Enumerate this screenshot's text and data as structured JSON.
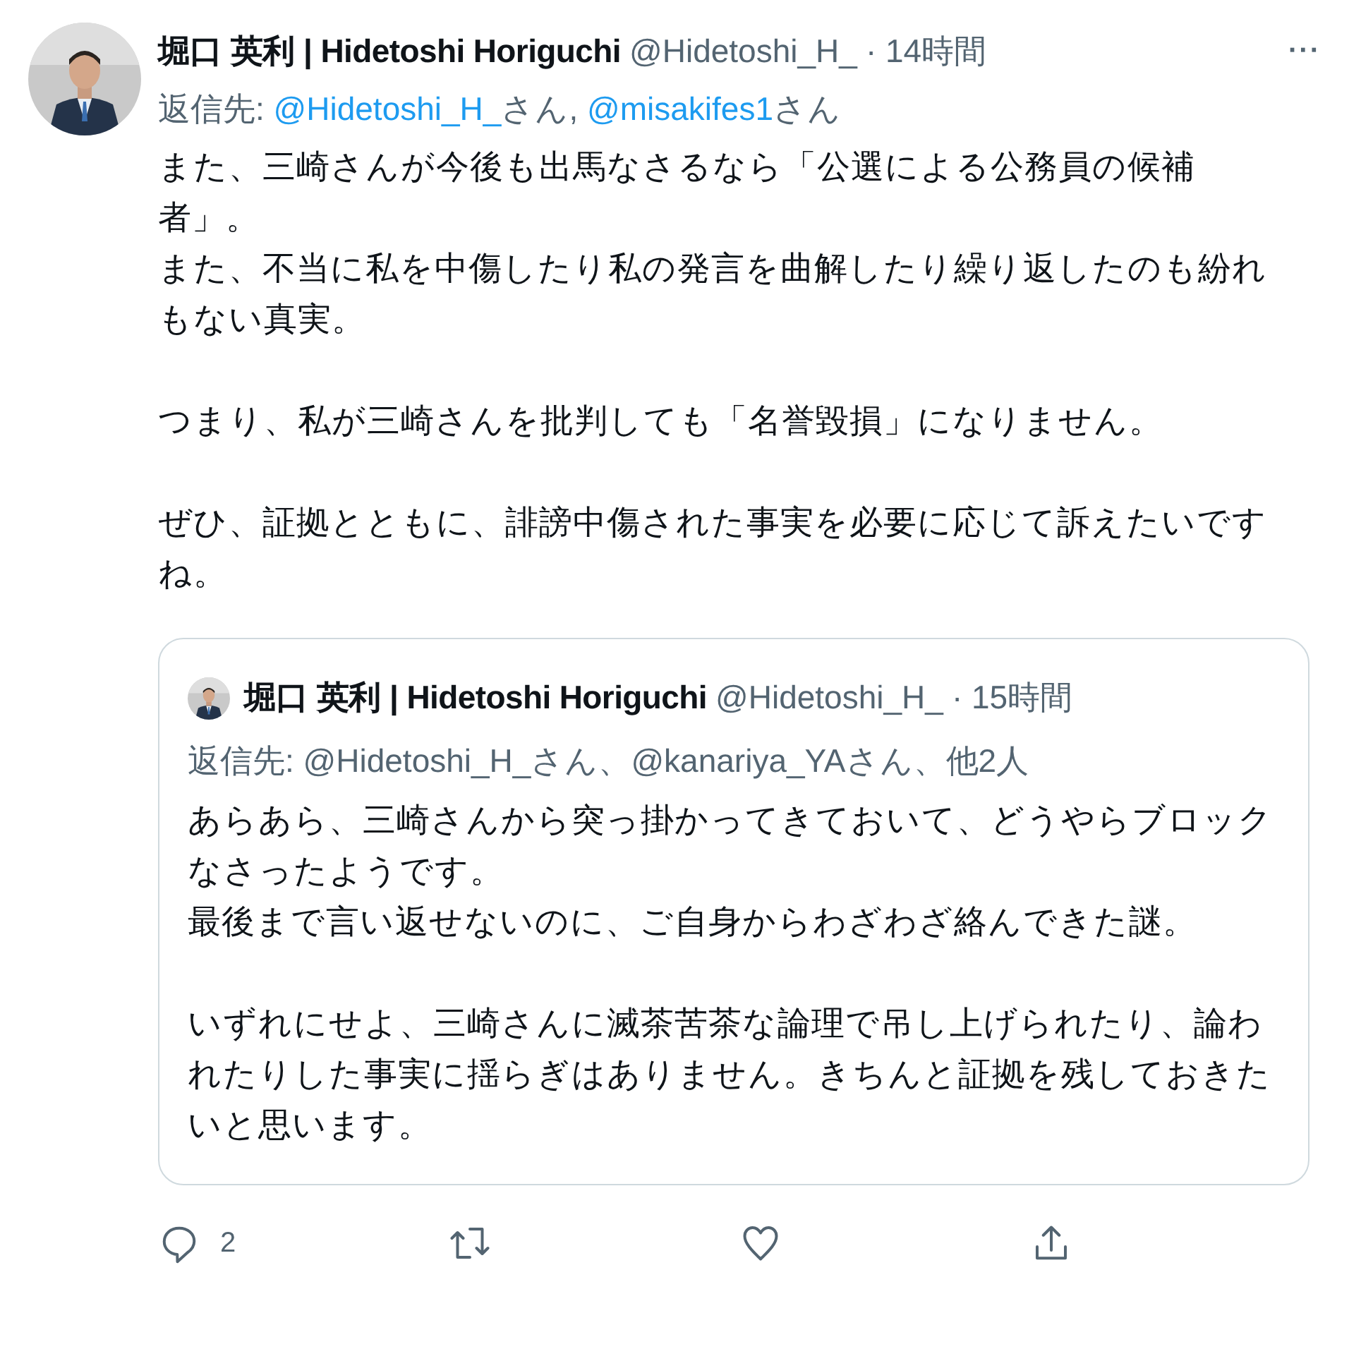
{
  "tweet": {
    "name": "堀口 英利 | Hidetoshi Horiguchi",
    "handle": "@Hidetoshi_H_",
    "time": "· 14時間",
    "more": "···",
    "reply_to": [
      {
        "kind": "plain",
        "text": "返信先: "
      },
      {
        "kind": "mention",
        "text": "@Hidetoshi_H_"
      },
      {
        "kind": "plain",
        "text": "さん, "
      },
      {
        "kind": "mention",
        "text": "@misakifes1"
      },
      {
        "kind": "plain",
        "text": "さん"
      }
    ],
    "paragraphs": [
      [
        "また、三崎さんが今後も出馬なさるなら「公選による公務員の候補者」。",
        "また、不当に私を中傷したり私の発言を曲解したり繰り返したのも紛れもない真実。"
      ],
      [
        "つまり、私が三崎さんを批判しても「名誉毀損」になりません。"
      ],
      [
        "ぜひ、証拠とともに、誹謗中傷された事実を必要に応じて訴えたいですね。"
      ]
    ],
    "quote": {
      "name": "堀口 英利 | Hidetoshi Horiguchi",
      "handle": "@Hidetoshi_H_",
      "time": "· 15時間",
      "reply_to": "返信先: @Hidetoshi_H_さん、@kanariya_YAさん、他2人",
      "paragraphs": [
        [
          "あらあら、三崎さんから突っ掛かってきておいて、どうやらブロックなさったようです。",
          "最後まで言い返せないのに、ご自身からわざわざ絡んできた謎。"
        ],
        [
          "いずれにせよ、三崎さんに滅茶苦茶な論理で吊し上げられたり、論われたりした事実に揺らぎはありません。きちんと証拠を残しておきたいと思います。"
        ]
      ]
    },
    "actions": [
      {
        "kind": "reply",
        "count": "2"
      },
      {
        "kind": "retweet"
      },
      {
        "kind": "like"
      },
      {
        "kind": "share"
      }
    ]
  }
}
